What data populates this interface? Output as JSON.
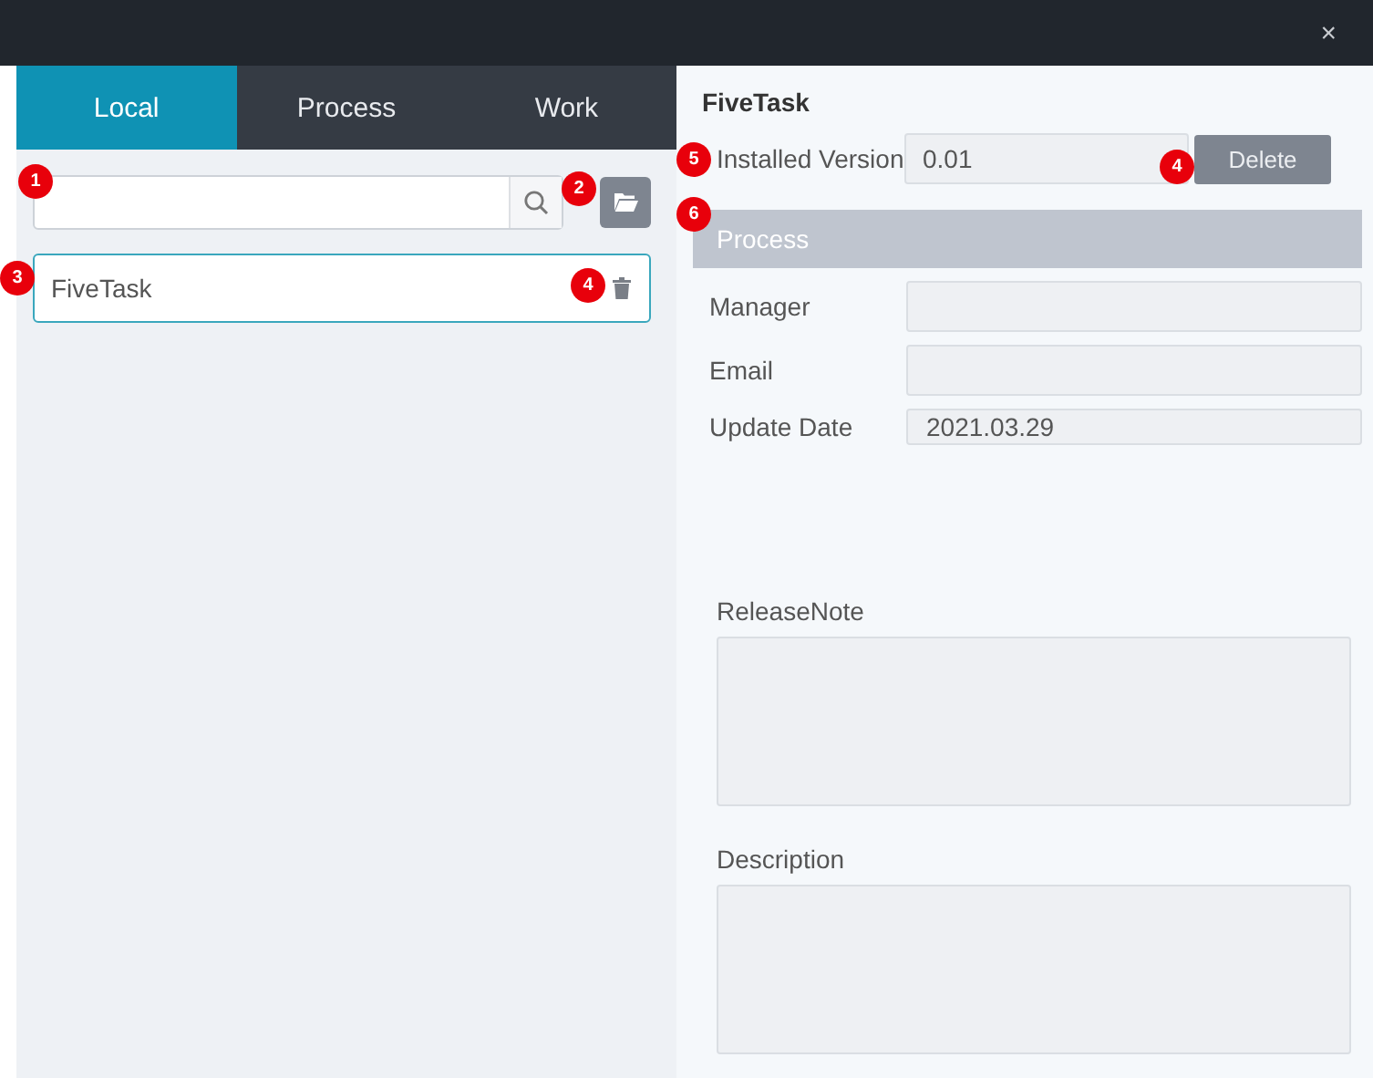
{
  "window": {
    "close": "×"
  },
  "tabs": [
    {
      "label": "Local",
      "selected": true
    },
    {
      "label": "Process",
      "selected": false
    },
    {
      "label": "Work",
      "selected": false
    }
  ],
  "search": {
    "badge": "1"
  },
  "folder_button": {
    "badge": "2"
  },
  "items": [
    {
      "name": "FiveTask",
      "badge": "3",
      "delete_badge": "4"
    }
  ],
  "detail": {
    "title": "FiveTask",
    "installed": {
      "label": "Installed Version",
      "value": "0.01",
      "badge": "5"
    },
    "delete_button": {
      "label": "Delete",
      "badge": "4"
    },
    "section": {
      "label": "Process",
      "badge": "6"
    },
    "fields": [
      {
        "label": "Manager",
        "kind": "tall"
      },
      {
        "label": "Email",
        "kind": "tall"
      },
      {
        "label": "Update Date",
        "value": "2021.03.29",
        "kind": "short"
      }
    ],
    "notes": [
      {
        "label": "ReleaseNote"
      },
      {
        "label": "Description"
      }
    ]
  }
}
